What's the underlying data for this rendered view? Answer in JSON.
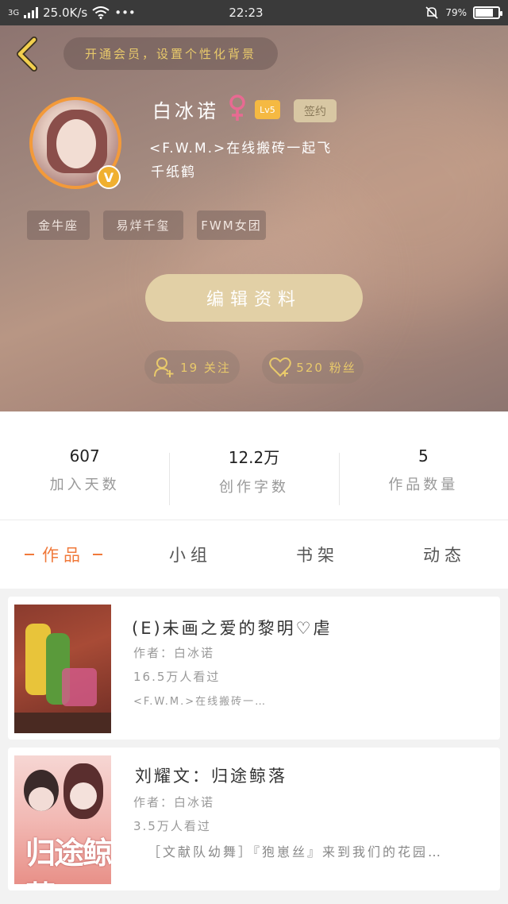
{
  "status_bar": {
    "network": "3G",
    "speed": "25.0K/s",
    "dots": "•••",
    "time": "22:23",
    "battery": "79%",
    "battery_level": 0.79
  },
  "header": {
    "vip_banner": "开通会员，设置个性化背景",
    "username": "白冰诺",
    "level_badge": "Lv5",
    "sign_badge": "签约",
    "bio_line1": "<F.W.M.>在线搬砖一起飞",
    "bio_line2": "千纸鹤",
    "v_badge": "V",
    "tags": [
      "金牛座",
      "易烊千玺",
      "FWM女团"
    ],
    "edit_button": "编辑资料",
    "follow_label": "19 关注",
    "fans_label": "520 粉丝"
  },
  "stats": [
    {
      "value": "607",
      "label": "加入天数"
    },
    {
      "value": "12.2万",
      "label": "创作字数"
    },
    {
      "value": "5",
      "label": "作品数量"
    }
  ],
  "tabs": [
    "作品",
    "小组",
    "书架",
    "动态"
  ],
  "works": [
    {
      "title": "(E)未画之爱的黎明♡虐",
      "author": "作者：白冰诺",
      "views": "16.5万人看过",
      "desc": "<F.W.M.>在线搬砖一…"
    },
    {
      "title": "刘耀文：归途鲸落",
      "author": "作者：白冰诺",
      "views": "3.5万人看过",
      "desc": "［文献队幼舞］『狍崽丝』来到我们的花园…",
      "cover_text": "归途鲸落"
    }
  ],
  "colors": {
    "accent": "#f0793a",
    "gold": "#e8c96b",
    "edit_button": "#e2d0a6",
    "avatar_ring": "#f39a3a"
  }
}
